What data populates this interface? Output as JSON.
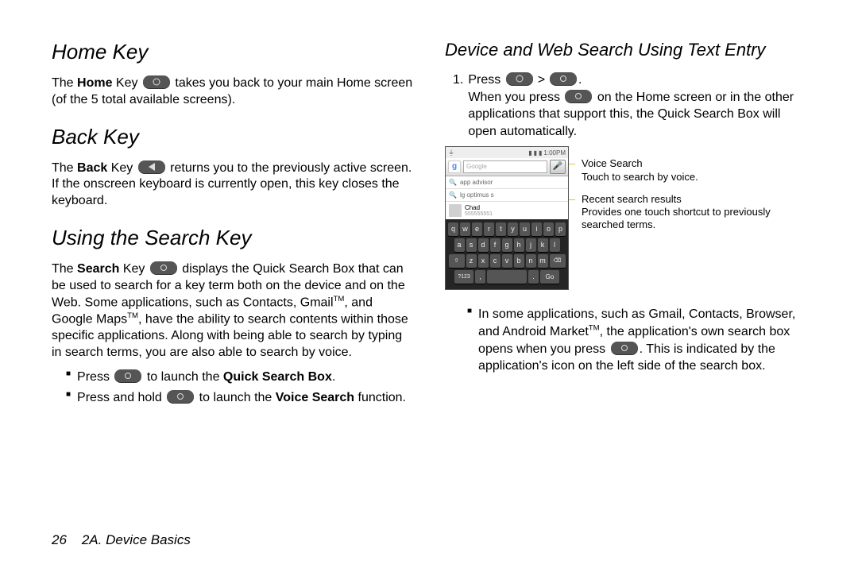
{
  "left": {
    "home": {
      "heading": "Home Key",
      "text_before_key": "The ",
      "bold_label": "Home",
      "text_mid": " Key ",
      "text_after_icon": " takes you back to your main Home screen (of the 5 total available screens)."
    },
    "back": {
      "heading": "Back Key",
      "text_before_key": "The ",
      "bold_label": "Back",
      "text_mid": " Key ",
      "text_after_icon": " returns you to the previously active screen. If the onscreen keyboard is currently open, this key closes the keyboard."
    },
    "search": {
      "heading": "Using the Search Key",
      "p1_before": "The ",
      "p1_bold": "Search",
      "p1_mid": " Key ",
      "p1_after": " displays the Quick Search Box that can be used to search for a key term both on the device and on the Web. Some applications, such as Contacts, Gmail",
      "p1_after2": ", and Google Maps",
      "p1_after3": ", have the ability to search contents within those specific applications. Along with being able to search by typing in search terms, you are also able to search by voice.",
      "bullet1_before": "Press ",
      "bullet1_after": " to launch the ",
      "bullet1_bold": "Quick Search Box",
      "bullet1_end": ".",
      "bullet2_before": "Press and hold ",
      "bullet2_after": " to launch the ",
      "bullet2_bold": "Voice Search",
      "bullet2_end": " function."
    }
  },
  "right": {
    "heading": "Device and Web Search Using Text Entry",
    "step1_before": "Press ",
    "step1_gt": ">",
    "step1_end": ".",
    "step1_para_before": "When you press ",
    "step1_para_after": " on the Home screen or in the other applications that support this, the Quick Search Box will open automatically.",
    "phone": {
      "time": "1:00PM",
      "search_placeholder": "Google",
      "sugg1": "app advisor",
      "sugg2": "lg optimus s",
      "contact_name": "Chad",
      "contact_num": "555555551",
      "keys_r1": [
        "q",
        "w",
        "e",
        "r",
        "t",
        "y",
        "u",
        "i",
        "o",
        "p"
      ],
      "keys_r2": [
        "a",
        "s",
        "d",
        "f",
        "g",
        "h",
        "j",
        "k",
        "l"
      ],
      "keys_r3_shift": "⇧",
      "keys_r3": [
        "z",
        "x",
        "c",
        "v",
        "b",
        "n",
        "m"
      ],
      "keys_r3_del": "⌫",
      "keys_r4_num": "?123",
      "keys_r4_comma": ",",
      "keys_r4_space": "",
      "keys_r4_period": ".",
      "keys_r4_go": "Go"
    },
    "callout1_title": "Voice Search",
    "callout1_sub": "Touch to search by voice.",
    "callout2_title": "Recent search results",
    "callout2_sub": "Provides one touch shortcut to previously searched terms.",
    "bullet_after_fig_before": "In some applications, such as Gmail, Contacts, Browser, and Android Market",
    "bullet_after_fig_mid": ", the application's own search box opens when you press ",
    "bullet_after_fig_after": ". This is indicated by the application's icon on the left side of the search box."
  },
  "footer": {
    "page": "26",
    "section": "2A. Device Basics"
  },
  "tm": "TM"
}
